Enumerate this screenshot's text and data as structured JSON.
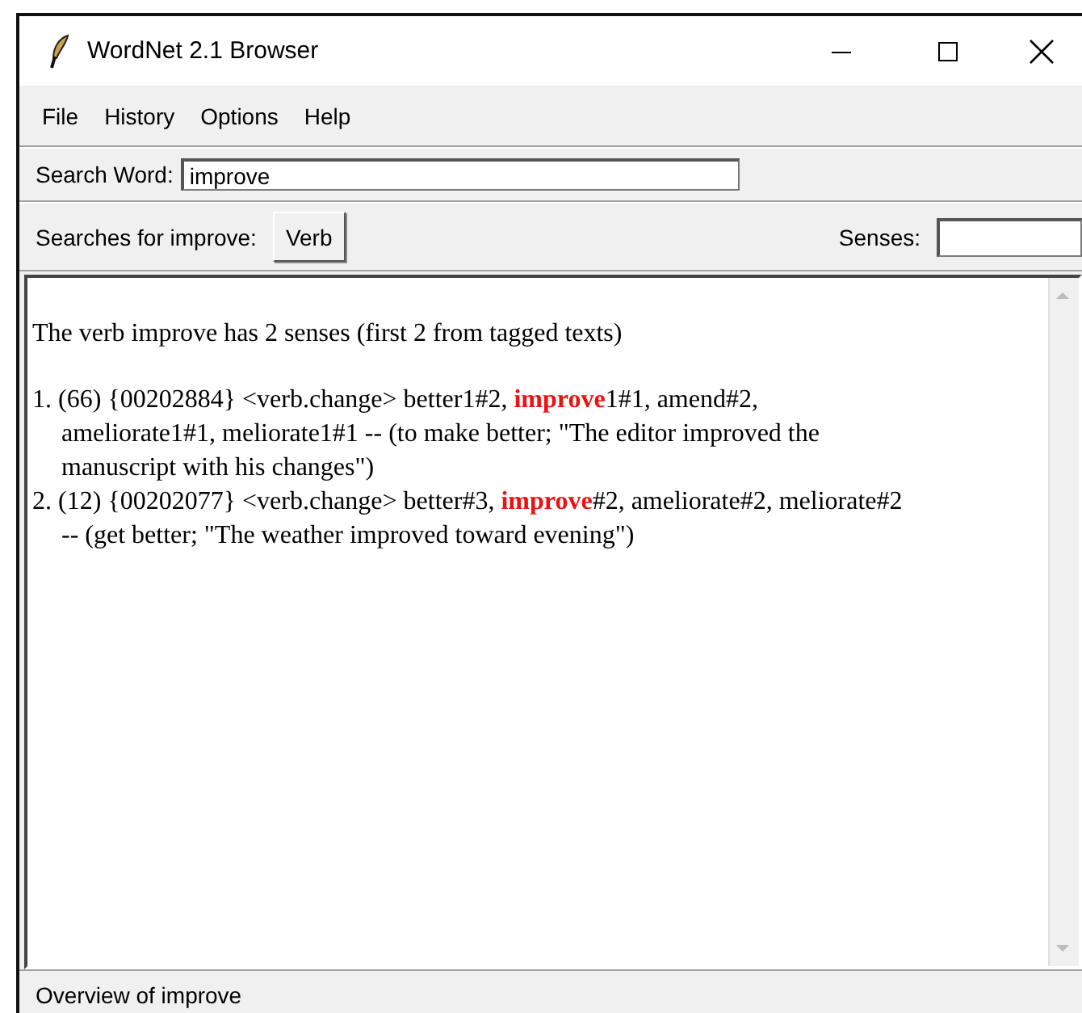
{
  "window": {
    "title": "WordNet 2.1 Browser"
  },
  "menu": [
    "File",
    "History",
    "Options",
    "Help"
  ],
  "search": {
    "label": "Search Word:",
    "value": "improve"
  },
  "searches": {
    "label": "Searches for improve:",
    "buttons": [
      "Verb"
    ],
    "senses_label": "Senses:"
  },
  "results": {
    "heading": "The verb improve has 2 senses (first 2 from tagged texts)",
    "senses": [
      "1. (66) {00202884} <verb.change> better1#2, **improve**1#1, amend#2, ameliorate1#1, meliorate1#1 -- (to make better; \"The editor improved the manuscript with his changes\")",
      "2. (12) {00202077} <verb.change> better#3, **improve**#2, ameliorate#2, meliorate#2 -- (get better; \"The weather improved toward evening\")"
    ]
  },
  "status_bar": "Overview of improve"
}
